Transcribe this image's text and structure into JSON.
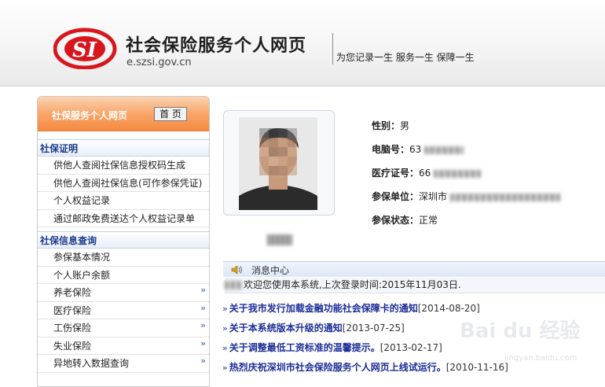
{
  "header": {
    "brand_title": "社会保险服务个人网页",
    "brand_url": "e.szsi.gov.cn",
    "slogan": "为您记录一生  服务一生  保障一生",
    "logo_text": "SI",
    "logo_colors": {
      "red": "#d7161d",
      "dark": "#333333"
    }
  },
  "sidebar": {
    "title": "社保服务个人网页",
    "home_label": "首 页",
    "groups": [
      {
        "label": "社保证明",
        "items": [
          {
            "label": "供他人查阅社保信息授权码生成"
          },
          {
            "label": "供他人查阅社保信息(可作参保凭证)"
          },
          {
            "label": "个人权益记录"
          },
          {
            "label": "通过邮政免费送达个人权益记录单"
          }
        ]
      },
      {
        "label": "社保信息查询",
        "items": [
          {
            "label": "参保基本情况"
          },
          {
            "label": "个人账户余额"
          },
          {
            "label": "养老保险",
            "arrow": "»"
          },
          {
            "label": "医疗保险",
            "arrow": "»"
          },
          {
            "label": "工伤保险",
            "arrow": "»"
          },
          {
            "label": "失业保险",
            "arrow": "»"
          },
          {
            "label": "异地转入数据查询",
            "arrow": "»"
          }
        ]
      }
    ]
  },
  "profile": {
    "gender_label": "性别：",
    "gender_value": "男",
    "computer_no_label": "电脑号：",
    "computer_no_value": "63",
    "medical_no_label": "医疗证号：",
    "medical_no_value": "66",
    "unit_label": "参保单位：",
    "unit_value": "深圳市",
    "status_label": "参保状态：",
    "status_value": "正常"
  },
  "messages": {
    "title": "消息中心",
    "welcome": "欢迎您使用本系统,上次登录时间:2015年11月03日.",
    "news": [
      {
        "title": "关于我市发行加载金融功能社会保障卡的通知",
        "date": "[2014-08-20]"
      },
      {
        "title": "关于本系统版本升级的通知",
        "date": "[2013-07-25]"
      },
      {
        "title": "关于调整最低工资标准的温馨提示。",
        "date": "[2013-02-17]"
      },
      {
        "title": "热烈庆祝深圳市社会保险服务个人网页上线试运行。",
        "date": "[2010-11-16]"
      }
    ],
    "news_marker": "»"
  },
  "watermark": {
    "main": "Bai du 经验",
    "sub": "jingyan.baidu.com"
  }
}
